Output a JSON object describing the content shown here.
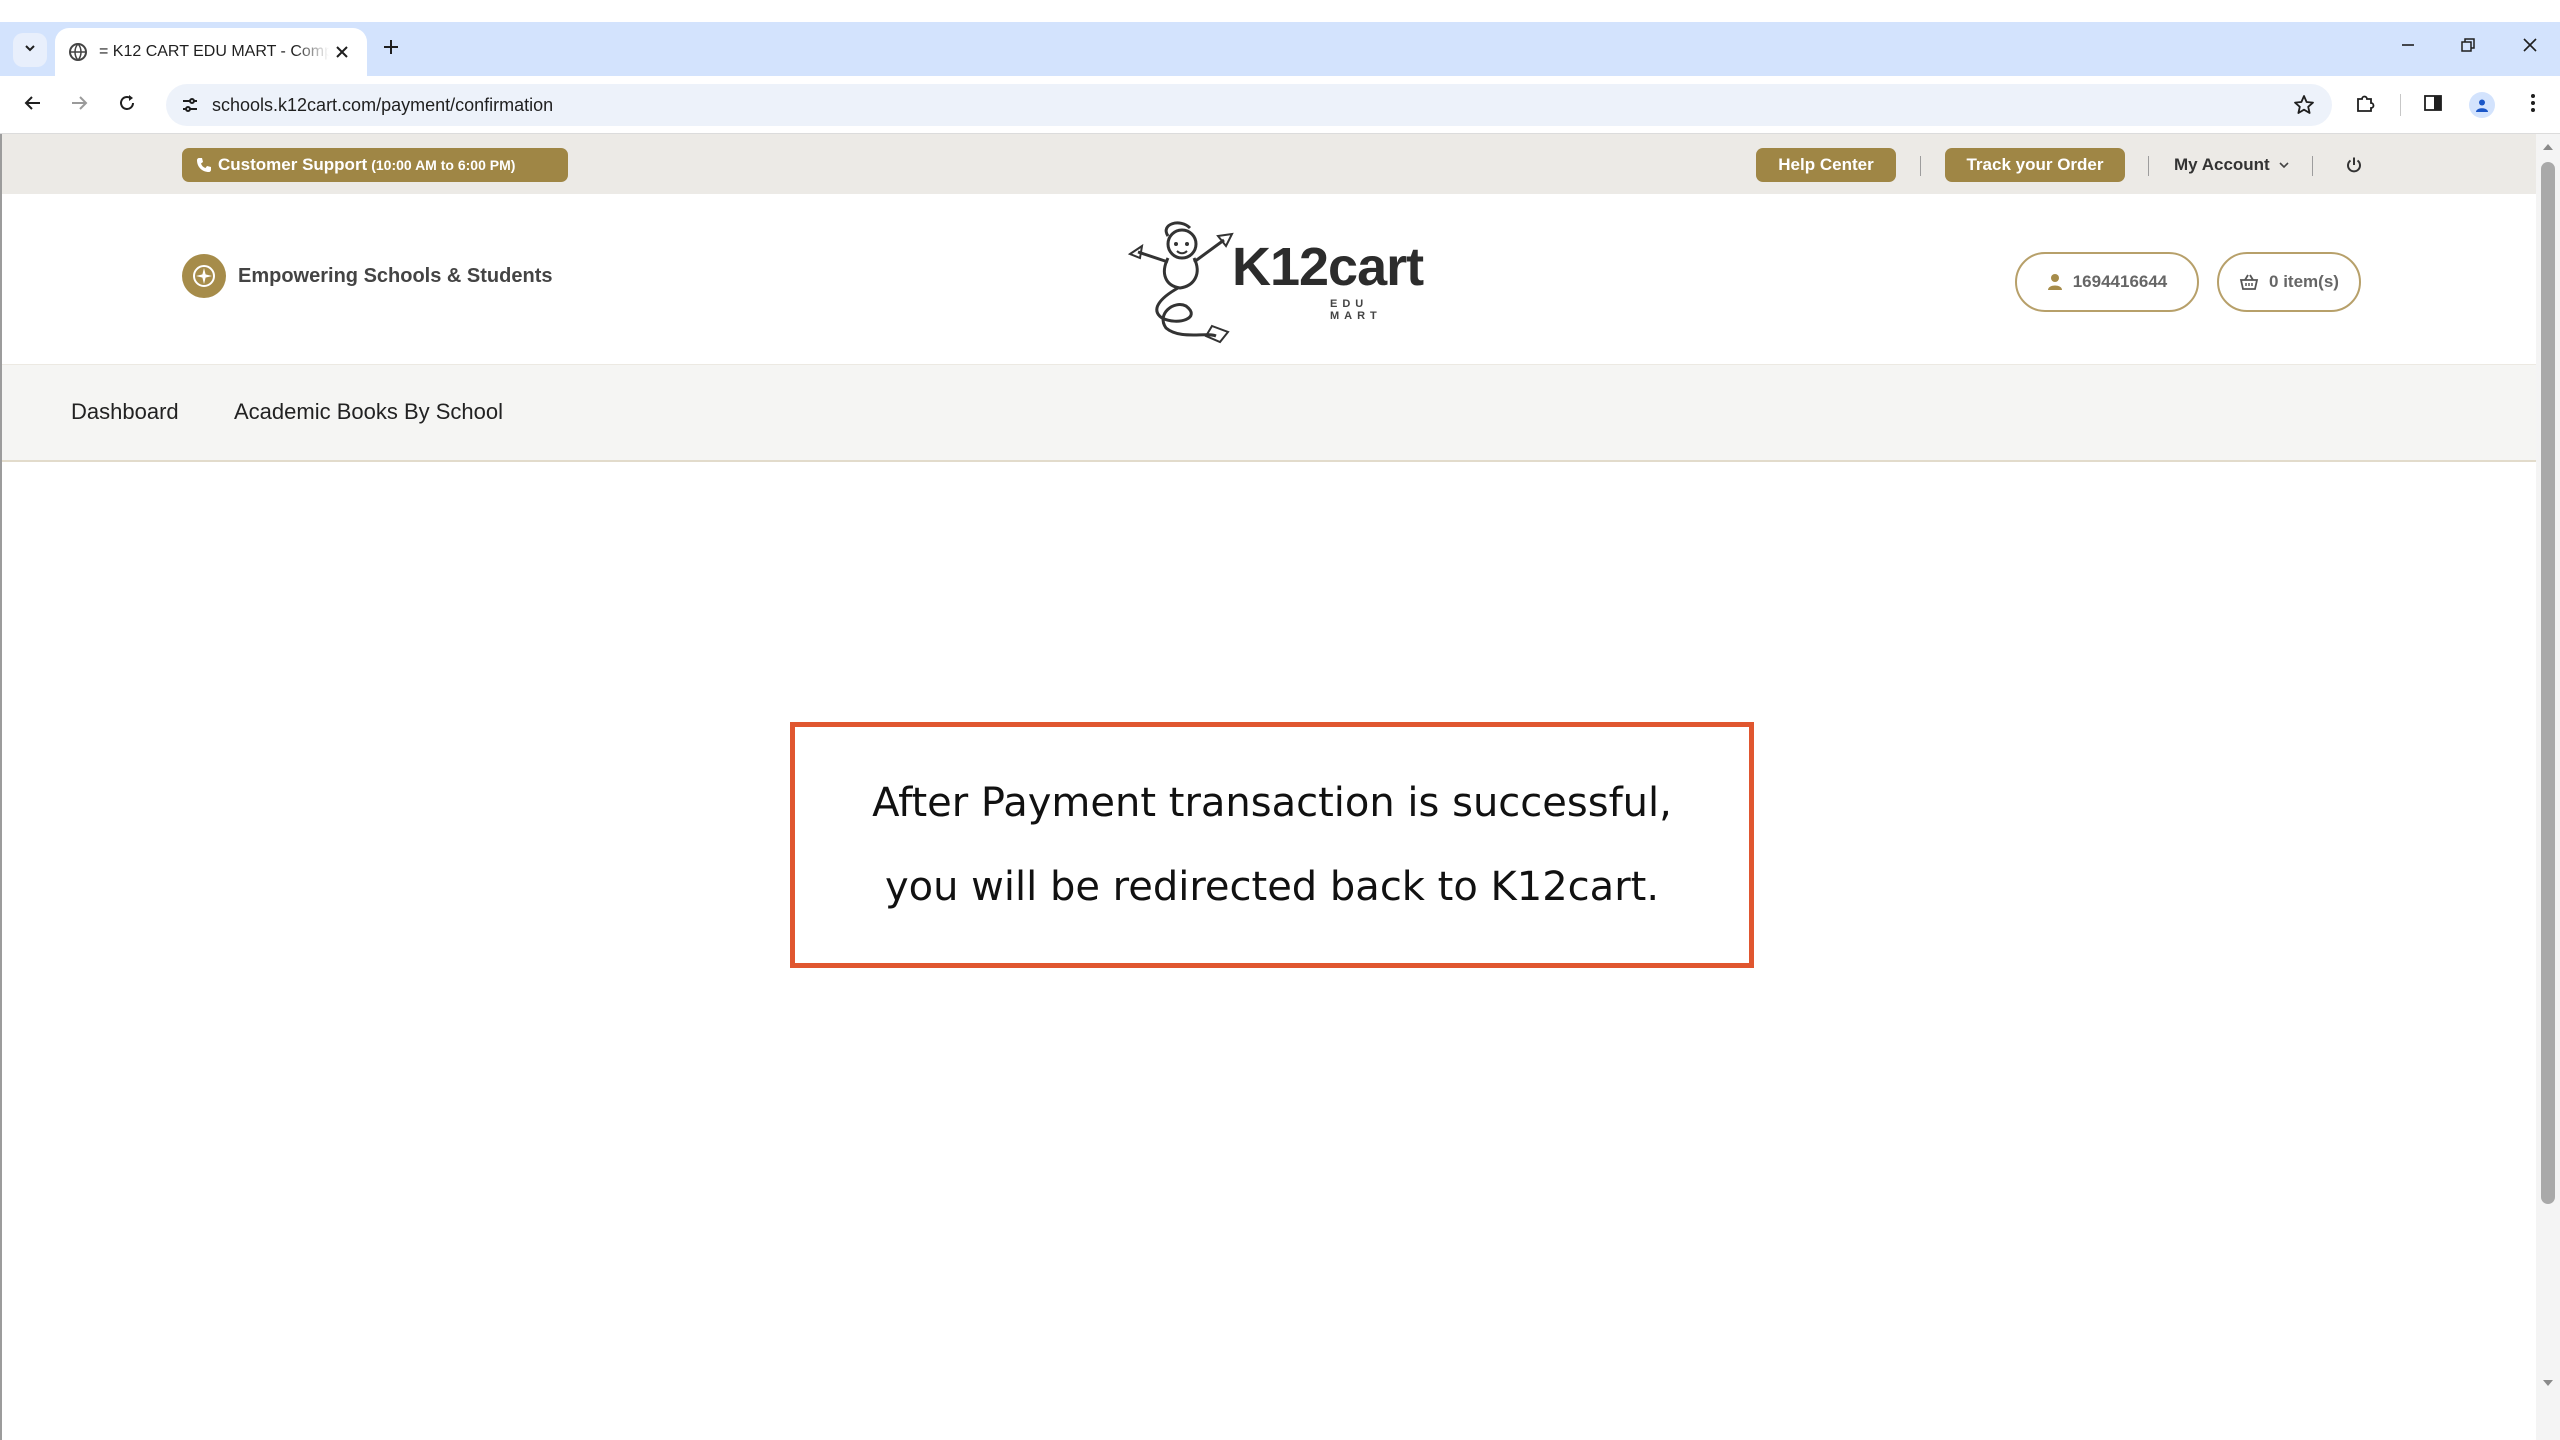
{
  "browser": {
    "tab_title": "= K12 CART EDU MART - Comp",
    "url": "schools.k12cart.com/payment/confirmation"
  },
  "topbar": {
    "support_label": "Customer Support",
    "support_hours": "(10:00 AM to 6:00 PM)",
    "help_center": "Help Center",
    "track_order": "Track your Order",
    "my_account": "My Account"
  },
  "header": {
    "tagline": "Empowering Schools & Students",
    "logo_word": "K12cart",
    "logo_sub": "EDU MART",
    "user_id": "1694416644",
    "cart": "0 item(s)"
  },
  "nav": {
    "items": [
      {
        "label": "Dashboard"
      },
      {
        "label": "Academic Books By School"
      }
    ]
  },
  "main": {
    "message_line1": "After Payment transaction is successful,",
    "message_line2": "you will be redirected back to K12cart."
  },
  "colors": {
    "brand_gold": "#9f8645",
    "callout_border": "#e0562f",
    "chrome_tabstrip": "#d3e3fd"
  }
}
